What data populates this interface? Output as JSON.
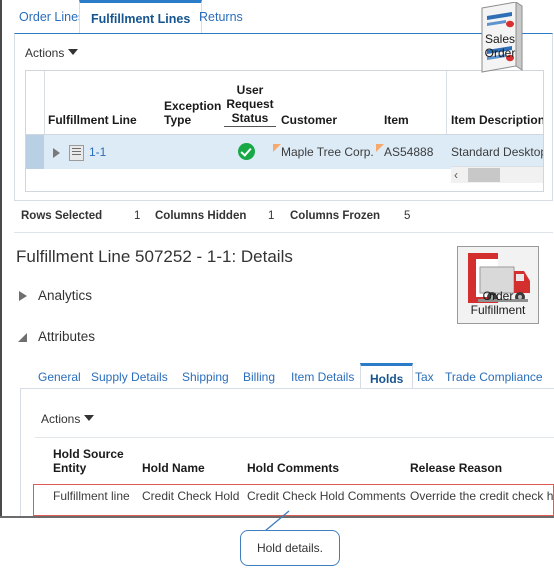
{
  "top_tabs": [
    {
      "label": "Order Lines",
      "active": false
    },
    {
      "label": "Fulfillment Lines",
      "active": true
    },
    {
      "label": "Returns",
      "active": false
    }
  ],
  "upper_panel": {
    "actions_label": "Actions",
    "sales_order_icon": {
      "name": "sales-order-document-icon",
      "caption_line1": "Sales",
      "caption_line2": "Order"
    },
    "grid": {
      "columns": [
        "Fulfillment Line",
        "Exception Type",
        "User Request Status",
        "Customer",
        "Item",
        "Item Description"
      ],
      "column_parts": {
        "exception_type_line1": "Exception",
        "exception_type_line2": "Type",
        "user_request_line1": "User",
        "user_request_line2": "Request",
        "user_request_line3": "Status"
      },
      "rows": [
        {
          "fulfillment_line": "1-1",
          "exception_type": "",
          "user_request_status": "success-check-icon",
          "customer": "Maple Tree Corp.",
          "item": "AS54888",
          "item_description": "Standard Desktop",
          "selected": true
        }
      ]
    },
    "scrollbar": {
      "left_chevron": "‹"
    }
  },
  "status_bar": {
    "rows_selected_label": "Rows Selected",
    "rows_selected_value": "1",
    "columns_hidden_label": "Columns Hidden",
    "columns_hidden_value": "1",
    "columns_frozen_label": "Columns Frozen",
    "columns_frozen_value": "5"
  },
  "details": {
    "title": "Fulfillment Line 507252 - 1-1: Details",
    "analytics_label": "Analytics",
    "analytics_expanded": false,
    "attributes_label": "Attributes",
    "attributes_expanded": true,
    "order_fulfillment_icon": {
      "name": "order-fulfillment-truck-icon",
      "caption_line1": "Order",
      "caption_line2": "Fulfillment"
    }
  },
  "sub_tabs": [
    {
      "label": "General",
      "active": false
    },
    {
      "label": "Supply Details",
      "active": false
    },
    {
      "label": "Shipping",
      "active": false
    },
    {
      "label": "Billing",
      "active": false
    },
    {
      "label": "Item Details",
      "active": false
    },
    {
      "label": "Holds",
      "active": true
    },
    {
      "label": "Tax",
      "active": false
    },
    {
      "label": "Trade Compliance",
      "active": false
    }
  ],
  "holds": {
    "actions_label": "Actions",
    "columns": [
      "Hold Source Entity",
      "Hold Name",
      "Hold Comments",
      "Release Reason"
    ],
    "column_parts": {
      "hold_source_line1": "Hold Source",
      "hold_source_line2": "Entity"
    },
    "rows": [
      {
        "hold_source_entity": "Fulfillment line",
        "hold_name": "Credit Check Hold",
        "hold_comments": "Credit Check Hold Comments",
        "release_reason": "Override the credit check hold"
      }
    ]
  },
  "callout": {
    "text": "Hold details."
  },
  "colors": {
    "accent_blue": "#2a7bc8",
    "link_blue": "#2a6ebb",
    "selected_row": "#ddebf7",
    "annotation_red": "#e05b55",
    "success_green": "#18a845",
    "flag_orange": "#f6a96a"
  }
}
